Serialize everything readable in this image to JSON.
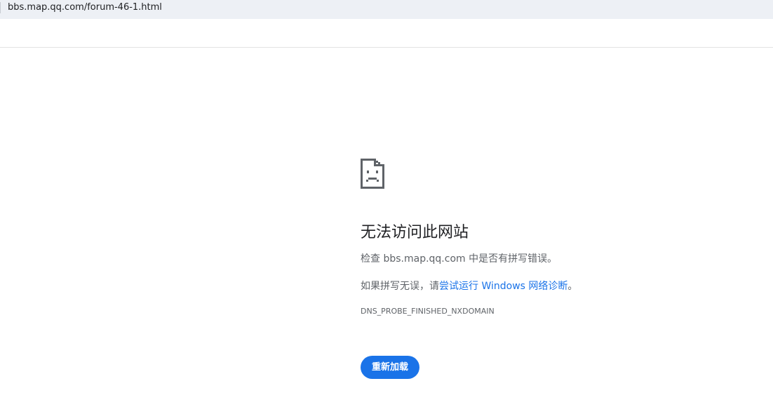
{
  "browser": {
    "url": "bbs.map.qq.com/forum-46-1.html"
  },
  "error_page": {
    "icon": "sad-page-icon",
    "title": "无法访问此网站",
    "check_prefix": "检查 ",
    "domain": "bbs.map.qq.com",
    "check_suffix": " 中是否有拼写错误。",
    "diag_prefix": "如果拼写无误，请",
    "diag_link": "尝试运行 Windows 网络诊断",
    "diag_suffix": "。",
    "error_code": "DNS_PROBE_FINISHED_NXDOMAIN",
    "reload_label": "重新加载"
  },
  "colors": {
    "accent": "#1a73e8",
    "text_primary": "#202124",
    "text_secondary": "#5f6368",
    "address_bar_bg": "#edf0f5"
  }
}
